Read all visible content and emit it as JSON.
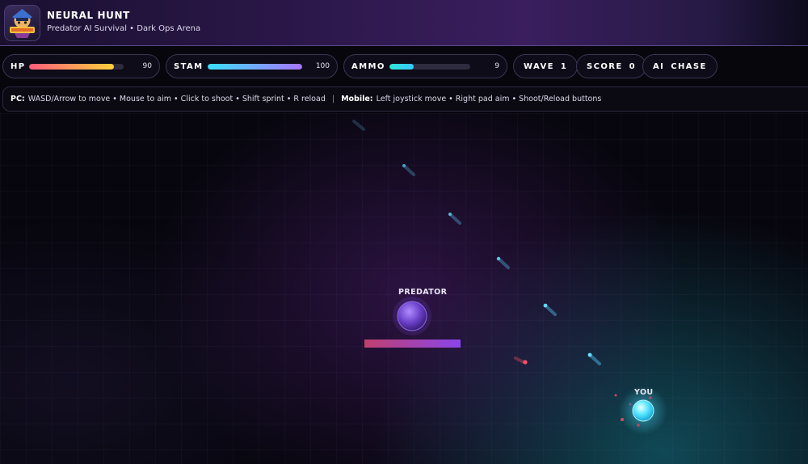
{
  "header": {
    "title": "NEURAL HUNT",
    "subtitle": "Predator AI Survival • Dark Ops Arena",
    "logo_icon": "hunter-badge-logo"
  },
  "stats": {
    "hp": {
      "label": "HP",
      "value": "90",
      "fraction": 0.9,
      "gradient": [
        "#ff5c7a",
        "#ffd23a"
      ]
    },
    "stamina": {
      "label": "STAM",
      "value": "100",
      "fraction": 1.0,
      "gradient": [
        "#39e0ff",
        "#a874ff"
      ]
    },
    "ammo": {
      "label": "AMMO",
      "value": "9",
      "fraction": 0.3,
      "gradient": [
        "#2ee8d4",
        "#38c8ff"
      ]
    },
    "wave": {
      "label": "WAVE",
      "value": "1"
    },
    "score": {
      "label": "SCORE",
      "value": "0"
    },
    "ai": {
      "label": "AI",
      "value": "CHASE"
    }
  },
  "controls": {
    "pc_label": "PC:",
    "pc_text": "WASD/Arrow to move • Mouse to aim • Click to shoot • Shift sprint • R reload",
    "separator": "|",
    "mobile_label": "Mobile:",
    "mobile_text": "Left joystick move • Right pad aim • Shoot/Reload buttons"
  },
  "arena": {
    "predator": {
      "label": "PREDATOR",
      "health_fraction": 1.0,
      "color": "#7a4fd6"
    },
    "player": {
      "label": "YOU",
      "color": "#4fe3ff"
    }
  }
}
